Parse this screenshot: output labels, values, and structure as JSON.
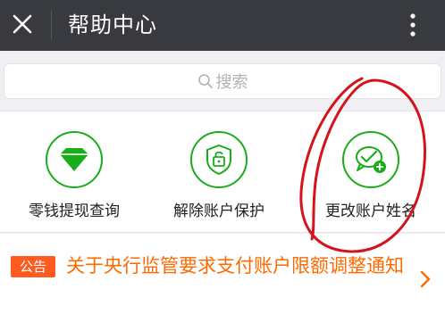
{
  "header": {
    "title": "帮助中心",
    "close_icon": "close-icon",
    "more_icon": "more-vertical-icon"
  },
  "search": {
    "placeholder": "搜索",
    "icon": "search-icon"
  },
  "grid": {
    "items": [
      {
        "label": "零钱提现查询",
        "icon": "diamond-icon"
      },
      {
        "label": "解除账户保护",
        "icon": "lock-shield-icon"
      },
      {
        "label": "更改账户姓名",
        "icon": "chat-check-icon"
      }
    ]
  },
  "notice": {
    "badge": "公告",
    "text": "关于央行监管要求支付账户限额调整通知",
    "chevron_icon": "chevron-right-icon"
  },
  "colors": {
    "header_bg": "#393a3f",
    "accent_green": "#1aad19",
    "notice_orange": "#ff6a00",
    "badge_bg": "#ff5a1f",
    "annotation_red": "#d4141c"
  }
}
